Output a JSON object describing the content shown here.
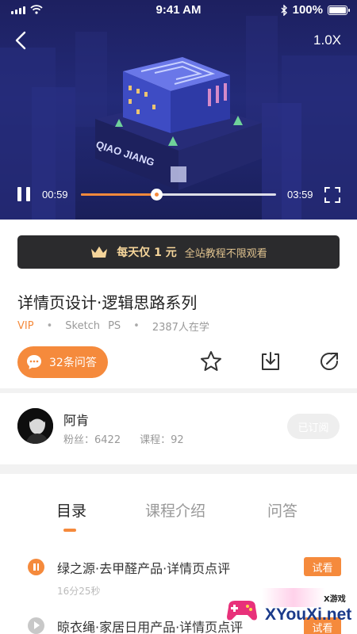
{
  "status_bar": {
    "time": "9:41 AM",
    "battery": "100%"
  },
  "player": {
    "speed": "1.0X",
    "current_time": "00:59",
    "duration": "03:59",
    "progress": 0.385,
    "artwork_text": "QIAO JIANG"
  },
  "vip_banner": {
    "main": "每天仅 1 元",
    "sub": "全站教程不限观看"
  },
  "course": {
    "title": "详情页设计·逻辑思路系列",
    "tag_vip": "VIP",
    "tag_tools_1": "Sketch",
    "tag_tools_2": "PS",
    "learners": "2387人在学",
    "qa_label": "32条问答"
  },
  "author": {
    "name": "阿肯",
    "fans": "粉丝：6422",
    "courses": "课程：92",
    "subscribe_label": "已订阅"
  },
  "tabs": [
    {
      "label": "目录"
    },
    {
      "label": "课程介绍"
    },
    {
      "label": "问答"
    }
  ],
  "lessons": [
    {
      "title": "绿之源·去甲醛产品·详情页点评",
      "duration": "16分25秒",
      "badge": "试看"
    },
    {
      "title": "晾衣绳·家居日用产品·详情页点评",
      "badge": "试看"
    }
  ],
  "watermark": {
    "text": "XYouXi.net",
    "sub": "X游戏"
  },
  "colors": {
    "accent": "#f58a3c",
    "banner_bg": "#2b2b2d",
    "banner_text": "#f4d49a"
  },
  "icons": [
    "back-icon",
    "pause-icon",
    "fullscreen-icon",
    "crown-icon",
    "chat-icon",
    "star-icon",
    "download-icon",
    "share-icon"
  ]
}
